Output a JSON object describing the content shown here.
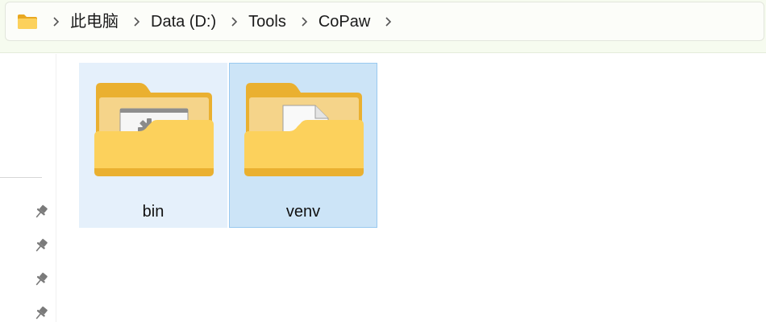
{
  "address_bar": {
    "folder_icon": "folder-icon",
    "breadcrumbs": [
      "此电脑",
      "Data (D:)",
      "Tools",
      "CoPaw"
    ]
  },
  "nav_pane": {
    "pinned_icon": "pin-icon",
    "pinned_count": 4
  },
  "files": [
    {
      "name": "bin",
      "icon": "folder-with-app-icon",
      "state": "hover"
    },
    {
      "name": "venv",
      "icon": "folder-with-file-icon",
      "state": "selected"
    }
  ],
  "colors": {
    "hover_bg": "#e5f0fb",
    "selected_bg": "#cce4f7",
    "selected_border": "#99c9ef",
    "folder_yellow": "#f8c943"
  }
}
